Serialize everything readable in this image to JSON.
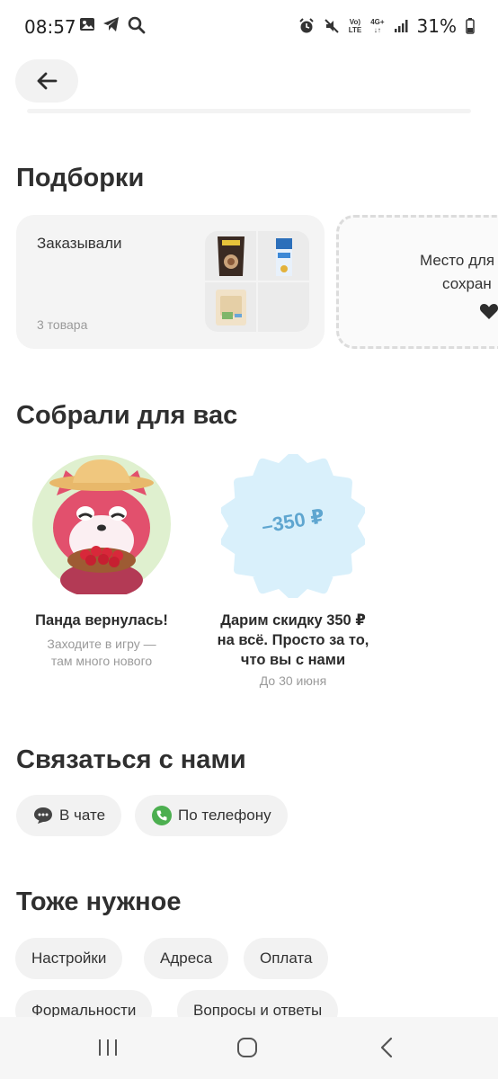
{
  "status_bar": {
    "time": "08:57",
    "battery": "31%",
    "volte_top": "Vo)",
    "volte_bottom": "LTE",
    "network_top": "4G+",
    "network_bottom": "↓↑"
  },
  "header": {
    "back_icon": "arrow-left-icon"
  },
  "collections": {
    "title": "Подборки",
    "ordered_card": {
      "title": "Заказывали",
      "count": "3 товара"
    },
    "save_card": {
      "line1": "Место для",
      "line2": "сохран"
    }
  },
  "for_you": {
    "title": "Собрали для вас",
    "promo1": {
      "title": "Панда вернулась!",
      "subtitle_line1": "Заходите в игру —",
      "subtitle_line2": "там много нового"
    },
    "promo2": {
      "badge": "–350 ₽",
      "title_line1": "Дарим скидку 350 ₽",
      "title_line2": "на всё. Просто за то,",
      "title_line3": "что вы с нами",
      "date": "До 30 июня"
    }
  },
  "contact": {
    "title": "Связаться с нами",
    "chat_label": "В чате",
    "phone_label": "По телефону"
  },
  "also": {
    "title": "Тоже нужное",
    "items": [
      "Настройки",
      "Адреса",
      "Оплата",
      "Формальности",
      "Вопросы и ответы"
    ]
  },
  "colors": {
    "accent_green": "#4caf50",
    "promo_blue": "#d9f0fb",
    "panda_red": "#e2506d"
  }
}
